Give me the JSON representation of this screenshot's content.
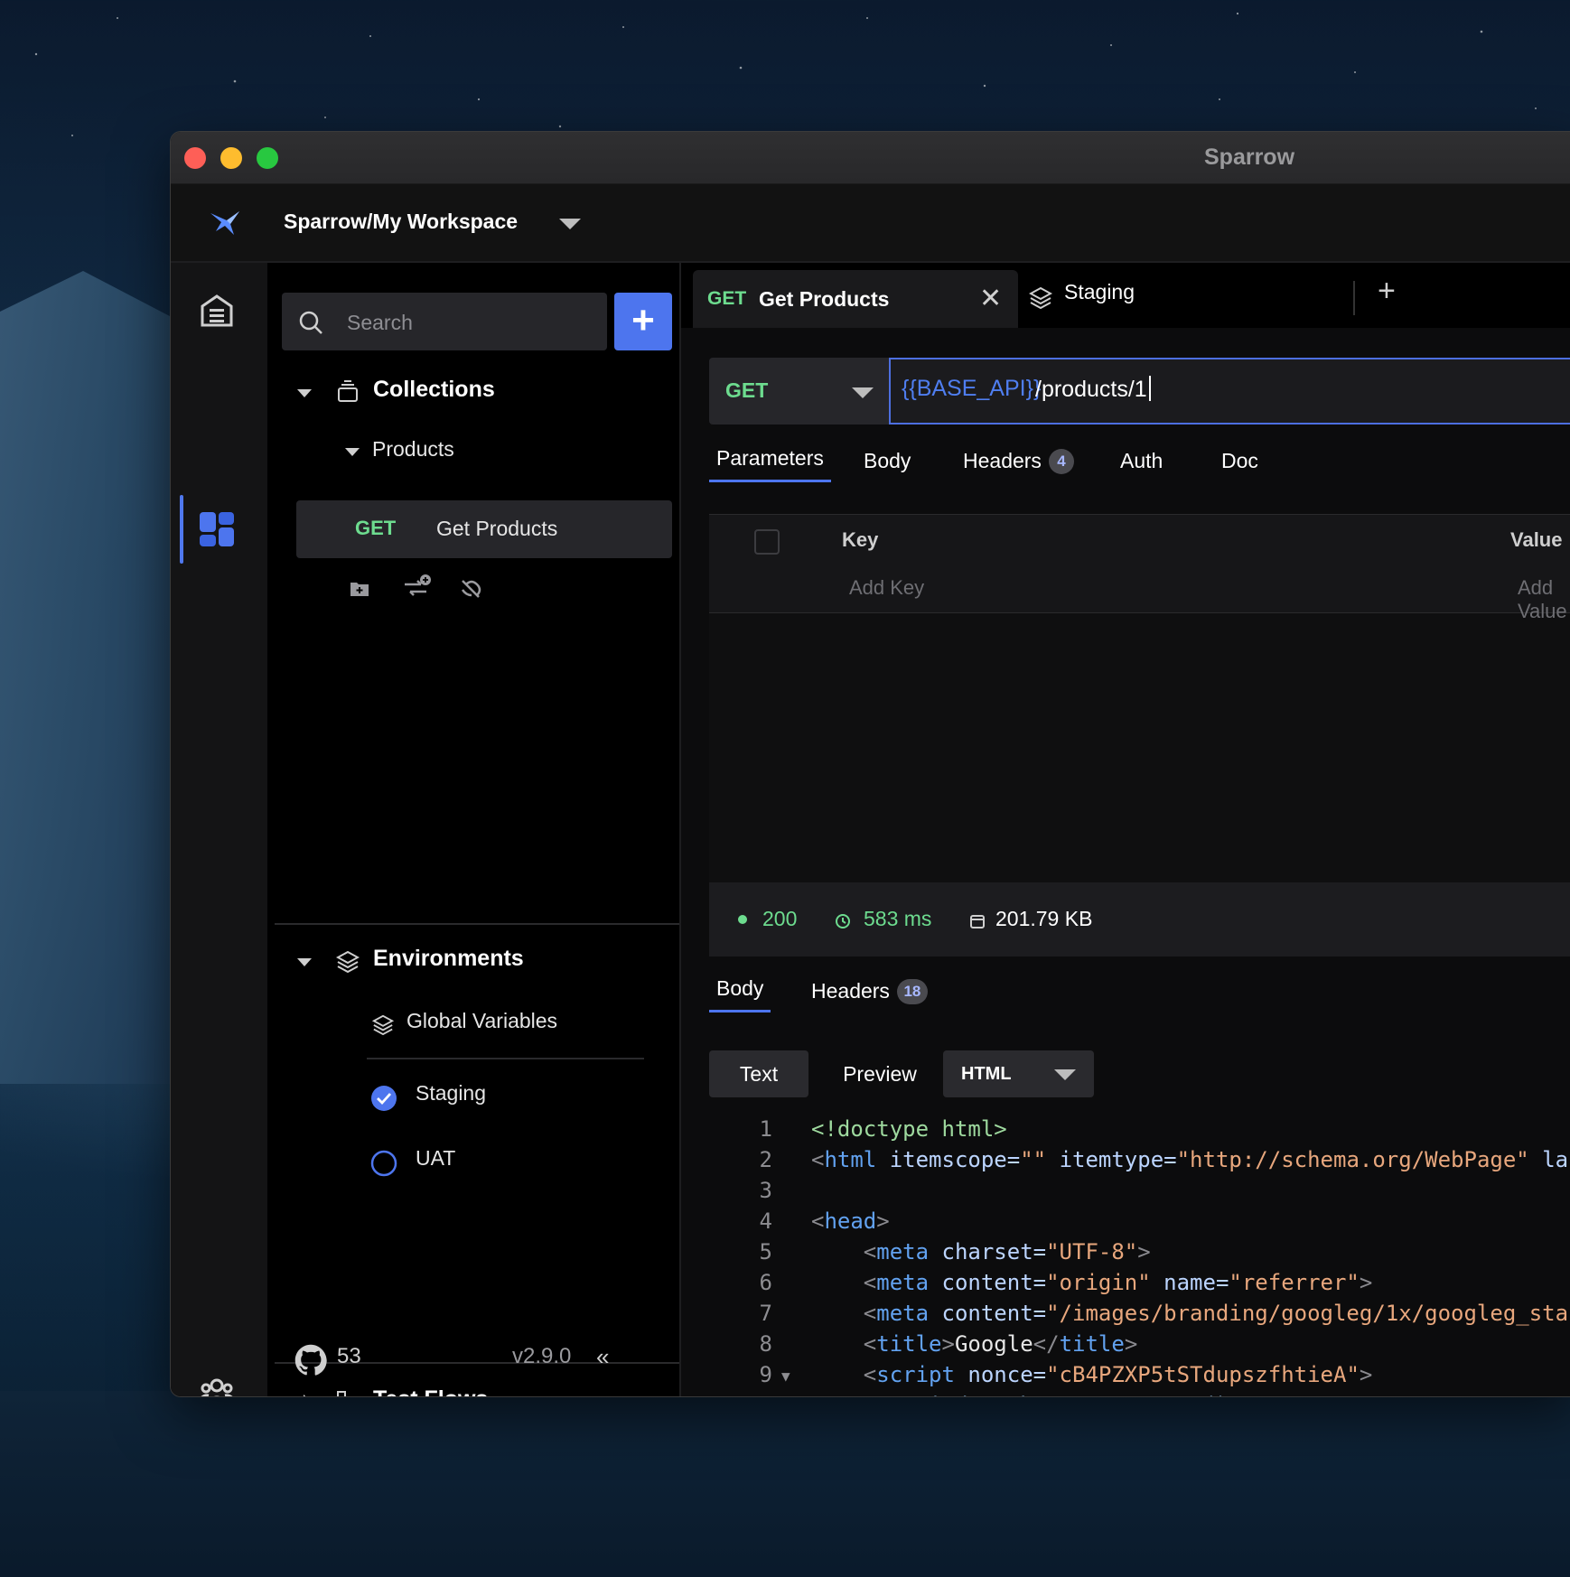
{
  "window": {
    "title": "Sparrow"
  },
  "workspace": {
    "name": "Sparrow/My Workspace"
  },
  "sidebar": {
    "search_placeholder": "Search",
    "add_label": "+",
    "collections": {
      "title": "Collections",
      "folder": "Products",
      "request": {
        "method": "GET",
        "name": "Get Products"
      }
    },
    "environments": {
      "title": "Environments",
      "global": "Global Variables",
      "items": [
        {
          "name": "Staging",
          "selected": true
        },
        {
          "name": "UAT",
          "selected": false
        }
      ]
    },
    "testflows": {
      "title": "Test Flows"
    },
    "footer": {
      "github_stars": "53",
      "version": "v2.9.0",
      "collapse": "«"
    }
  },
  "tabs": [
    {
      "method": "GET",
      "name": "Get Products",
      "close": "✕"
    },
    {
      "name": "Staging"
    }
  ],
  "tab_add": "+",
  "request": {
    "method": "GET",
    "url_var": "{{BASE_API}}",
    "url_path": "/products/1"
  },
  "request_tabs": {
    "parameters": "Parameters",
    "body": "Body",
    "headers": "Headers",
    "headers_count": "4",
    "auth": "Auth",
    "doc": "Doc"
  },
  "params_table": {
    "key_header": "Key",
    "value_header": "Value",
    "key_placeholder": "Add Key",
    "value_placeholder": "Add Value"
  },
  "response": {
    "status": "200",
    "time": "583 ms",
    "size": "201.79 KB",
    "tabs": {
      "body": "Body",
      "headers": "Headers",
      "headers_count": "18"
    },
    "view": {
      "text": "Text",
      "preview": "Preview",
      "format": "HTML"
    }
  },
  "colors": {
    "accent": "#4d75ee",
    "method_get": "#6ddc8f",
    "url_variable": "#4f7ef0"
  }
}
